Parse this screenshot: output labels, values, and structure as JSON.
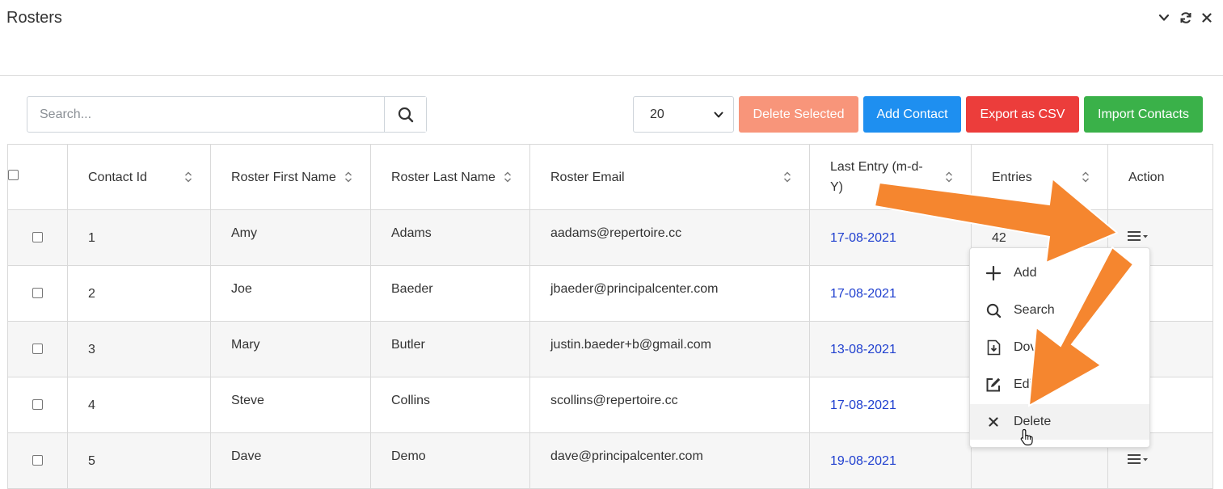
{
  "header": {
    "title": "Rosters"
  },
  "toolbar": {
    "search_placeholder": "Search...",
    "page_size": "20",
    "delete_selected": "Delete Selected",
    "add_contact": "Add Contact",
    "export_csv": "Export as CSV",
    "import_contacts": "Import Contacts"
  },
  "table": {
    "columns": [
      "Contact Id",
      "Roster First Name",
      "Roster Last Name",
      "Roster Email",
      "Last Entry (m-d-Y)",
      "Entries",
      "Action"
    ],
    "rows": [
      {
        "id": "1",
        "first": "Amy",
        "last": "Adams",
        "email": "aadams@repertoire.cc",
        "date": "17-08-2021",
        "entries": "42"
      },
      {
        "id": "2",
        "first": "Joe",
        "last": "Baeder",
        "email": "jbaeder@principalcenter.com",
        "date": "17-08-2021",
        "entries": ""
      },
      {
        "id": "3",
        "first": "Mary",
        "last": "Butler",
        "email": "justin.baeder+b@gmail.com",
        "date": "13-08-2021",
        "entries": ""
      },
      {
        "id": "4",
        "first": "Steve",
        "last": "Collins",
        "email": "scollins@repertoire.cc",
        "date": "17-08-2021",
        "entries": ""
      },
      {
        "id": "5",
        "first": "Dave",
        "last": "Demo",
        "email": "dave@principalcenter.com",
        "date": "19-08-2021",
        "entries": ""
      }
    ]
  },
  "action_menu": {
    "items": [
      "Add",
      "Search",
      "Dov",
      "Edi",
      "Delete"
    ],
    "icons": [
      "plus-icon",
      "search-icon",
      "download-icon",
      "edit-icon",
      "close-icon"
    ]
  },
  "colors": {
    "delete_selected": "#f8957a",
    "add_contact": "#1e8ff0",
    "export_csv": "#ec3d3b",
    "import_contacts": "#3ab149",
    "date_link": "#1f3fcf",
    "annotation_arrow": "#f5862f"
  }
}
